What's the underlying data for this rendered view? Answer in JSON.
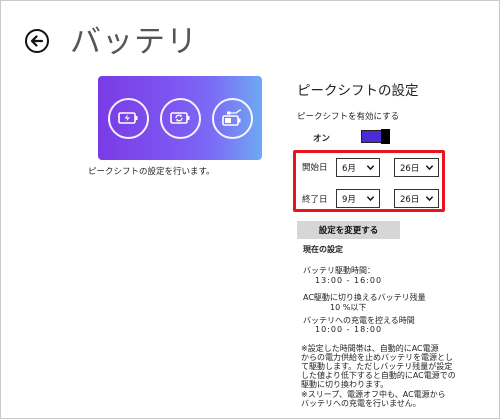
{
  "window": {
    "title": "バッテリ"
  },
  "hero": {
    "icons": [
      "battery-charging-icon",
      "refresh-icon",
      "battery-plug-icon"
    ]
  },
  "left_description": "ピークシフトの設定を行います。",
  "peak_shift": {
    "section_title": "ピークシフトの設定",
    "enable_label": "ピークシフトを有効にする",
    "toggle_state": "オン",
    "toggle_on": true,
    "start": {
      "label": "開始日",
      "month": "6月",
      "day": "26日"
    },
    "end": {
      "label": "終了日",
      "month": "9月",
      "day": "26日"
    },
    "apply_button": "設定を変更する"
  },
  "current": {
    "heading": "現在の設定",
    "battery_time_label": "バッテリ駆動時間：",
    "battery_time_value": "13:00 - 16:00",
    "switch_label": "AC駆動に切り換えるバッテリ残量",
    "switch_value": "10 %以下",
    "charge_label": "バッテリへの充電を控える時間",
    "charge_value": "10:00 - 18:00",
    "notes": [
      "※設定した時間帯は、自動的にAC電源",
      "からの電力供給を止めバッテリを電源とし",
      "て駆動します。ただしバッテリ残量が設定",
      "した値より低下すると自動的にAC電源での",
      "駆動に切り換わります。",
      "※スリープ、電源オフ中も、AC電源から",
      "バッテリへの充電を行いません。"
    ]
  },
  "colors": {
    "accent": "#4b2bd6",
    "highlight": "#e8141f",
    "hero_gradient_start": "#7a3be6",
    "hero_gradient_end": "#6fa9f3"
  }
}
